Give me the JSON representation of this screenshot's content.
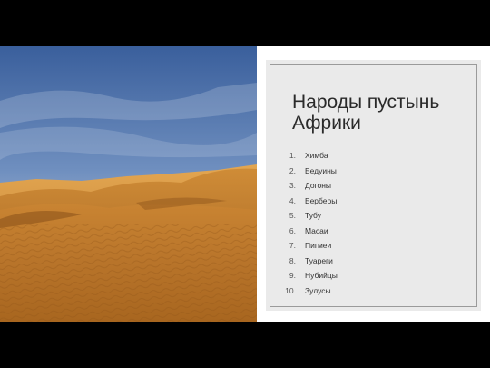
{
  "slide": {
    "title": "Народы пустынь Африки",
    "items": [
      {
        "num": "1.",
        "label": "Химба"
      },
      {
        "num": "2.",
        "label": "Бедуины"
      },
      {
        "num": "3.",
        "label": "Догоны"
      },
      {
        "num": "4.",
        "label": "Берберы"
      },
      {
        "num": "5.",
        "label": "Тубу"
      },
      {
        "num": "6.",
        "label": "Масаи"
      },
      {
        "num": "7.",
        "label": "Пигмеи"
      },
      {
        "num": "8.",
        "label": "Туареги"
      },
      {
        "num": "9.",
        "label": "Нубийцы"
      },
      {
        "num": "10.",
        "label": "Зулусы"
      }
    ]
  },
  "colors": {
    "background": "#000000",
    "slide": "#ffffff",
    "panel": "#eaeaea",
    "panel_border": "#9a9a9a",
    "sand": "#c8862f",
    "sky": "#3f6aa6"
  }
}
